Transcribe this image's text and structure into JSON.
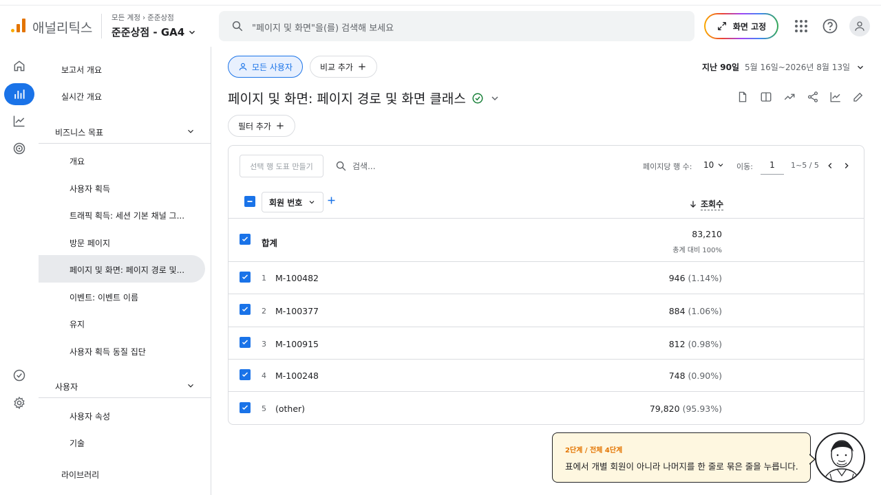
{
  "app": {
    "brand": "애널리틱스"
  },
  "header": {
    "crumb_account": "모든 계정",
    "crumb_sep": "›",
    "crumb_property": "준준상점",
    "property_name": "준준상점 - GA4",
    "search_placeholder": "\"페이지 및 화면\"을(를) 검색해 보세요",
    "pin_label": "화면 고정"
  },
  "nav": {
    "report_overview": "보고서 개요",
    "realtime_overview": "실시간 개요",
    "section_business": "비즈니스 목표",
    "items": [
      "개요",
      "사용자 획득",
      "트래픽 획득: 세션 기본 채널 그...",
      "방문 페이지",
      "페이지 및 화면: 페이지 경로 및...",
      "이벤트: 이벤트 이름",
      "유지",
      "사용자 획득 동질 집단"
    ],
    "section_user": "사용자",
    "user_items": [
      "사용자 속성",
      "기술"
    ],
    "library": "라이브러리"
  },
  "content": {
    "segment_pill": "모든 사용자",
    "compare_pill": "비교 추가",
    "date_period": "지난 90일",
    "date_range": "5월 16일~2026년 8월 13일",
    "page_title": "페이지 및 화면: 페이지 경로 및 화면 클래스",
    "filter_label": "필터 추가"
  },
  "table": {
    "make_plot_btn": "선택 행 도표 만들기",
    "search_placeholder": "검색...",
    "rows_per_page_label": "페이지당 행 수:",
    "rows_per_page": "10",
    "goto_label": "이동:",
    "goto_value": "1",
    "range_label": "1~5 / 5",
    "dimension": "회원 번호",
    "metric": "조회수",
    "total_label": "합계",
    "total_value": "83,210",
    "total_sub": "총계 대비 100%",
    "rows": [
      {
        "idx": "1",
        "label": "M-100482",
        "value": "946",
        "pct": "(1.14%)"
      },
      {
        "idx": "2",
        "label": "M-100377",
        "value": "884",
        "pct": "(1.06%)"
      },
      {
        "idx": "3",
        "label": "M-100915",
        "value": "812",
        "pct": "(0.98%)"
      },
      {
        "idx": "4",
        "label": "M-100248",
        "value": "748",
        "pct": "(0.90%)"
      },
      {
        "idx": "5",
        "label": "(other)",
        "value": "79,820",
        "pct": "(95.93%)"
      }
    ]
  },
  "tooltip": {
    "step": "2단계 / 전체 4단계",
    "message": "표에서 개별 회원이 아니라 나머지를 한 줄로 묶은 줄을 누릅니다."
  },
  "colors": {
    "accent": "#1a73e8",
    "brand_orange": "#e37400",
    "tooltip_bg": "#fef7e0"
  },
  "icons": [
    "home-icon",
    "reports-icon",
    "explore-icon",
    "advertising-icon",
    "admin-icon",
    "check-icon",
    "apps-icon",
    "help-icon",
    "account-icon"
  ]
}
